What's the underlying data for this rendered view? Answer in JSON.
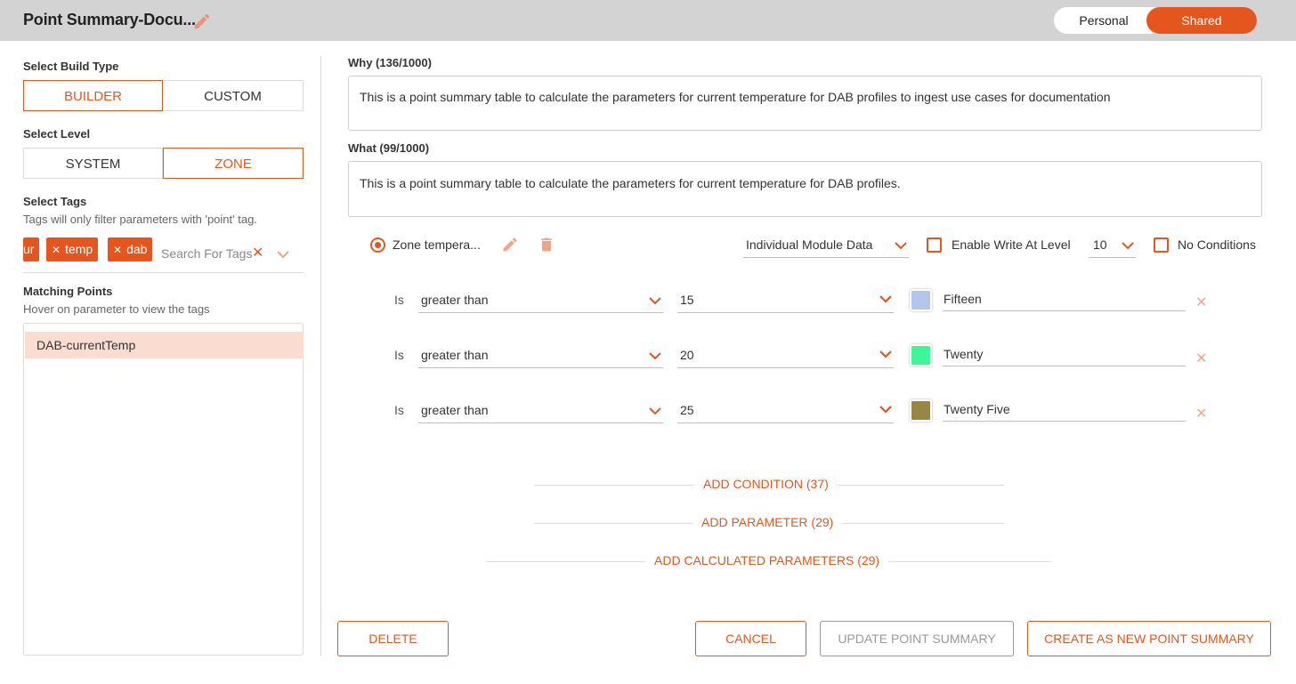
{
  "header": {
    "title": "Point Summary-Docu...",
    "toggle": {
      "personal": "Personal",
      "shared": "Shared",
      "selected": "Shared"
    }
  },
  "left": {
    "build_type_label": "Select Build Type",
    "build_type_options": [
      "BUILDER",
      "CUSTOM"
    ],
    "build_type_selected": "BUILDER",
    "level_label": "Select Level",
    "level_options": [
      "SYSTEM",
      "ZONE"
    ],
    "level_selected": "ZONE",
    "tags_label": "Select Tags",
    "tags_hint": "Tags will only filter parameters with 'point' tag.",
    "tags": [
      "ur",
      "temp",
      "dab"
    ],
    "tags_search_placeholder": "Search For Tags",
    "matching_label": "Matching Points",
    "matching_hint": "Hover on parameter to view the tags",
    "matching_points": [
      "DAB-currentTemp"
    ]
  },
  "main": {
    "why_label": "Why (136/1000)",
    "why_text": "This is a point summary table to calculate the parameters for current temperature for DAB profiles to ingest use cases for documentation",
    "what_label": "What (99/1000)",
    "what_text": "This is a point summary table to calculate the parameters for current temperature for DAB profiles.",
    "parameter": {
      "name": "Zone tempera...",
      "data_source": "Individual Module Data",
      "enable_write_label": "Enable Write At Level",
      "write_level": "10",
      "no_conditions_label": "No Conditions"
    },
    "conditions": [
      {
        "is": "Is",
        "operator": "greater than",
        "value": "15",
        "color": "#b4c6ec",
        "label": "Fifteen"
      },
      {
        "is": "Is",
        "operator": "greater than",
        "value": "20",
        "color": "#3ef598",
        "label": "Twenty"
      },
      {
        "is": "Is",
        "operator": "greater than",
        "value": "25",
        "color": "#978745",
        "label": "Twenty Five"
      }
    ],
    "add_condition": "ADD CONDITION (37)",
    "add_parameter": "ADD PARAMETER (29)",
    "add_calculated": "ADD CALCULATED PARAMETERS (29)"
  },
  "footer": {
    "delete": "DELETE",
    "cancel": "CANCEL",
    "update": "UPDATE POINT SUMMARY",
    "create": "CREATE AS NEW POINT SUMMARY"
  },
  "colors": {
    "accent": "#e4561d",
    "header_bg": "#d3d3d3",
    "selected_row": "#fbdcd0"
  },
  "icons": [
    "pencil-icon",
    "trash-icon",
    "chevron-down-icon",
    "close-icon",
    "radio-selected-icon",
    "checkbox-icon"
  ]
}
